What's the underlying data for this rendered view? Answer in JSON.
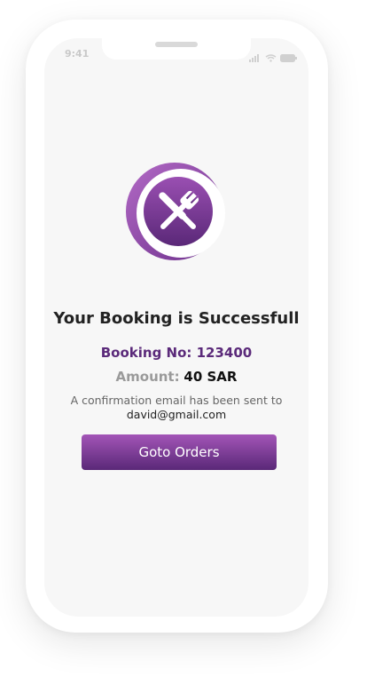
{
  "status_bar": {
    "time": "9:41"
  },
  "confirmation": {
    "title": "Your Booking is Successfull",
    "booking_label": "Booking No: 123400",
    "amount_label": "Amount:",
    "amount_value": "40 SAR",
    "message": "A confirmation email has been sent to",
    "email": "david@gmail.com"
  },
  "actions": {
    "goto_orders_label": "Goto Orders"
  },
  "icons": {
    "logo": "fork-knife-icon",
    "signal": "signal-icon",
    "wifi": "wifi-icon",
    "battery": "battery-icon"
  },
  "colors": {
    "accent": "#5b2a7a",
    "accent_light": "#a355b7",
    "background": "#f7f7f7"
  }
}
